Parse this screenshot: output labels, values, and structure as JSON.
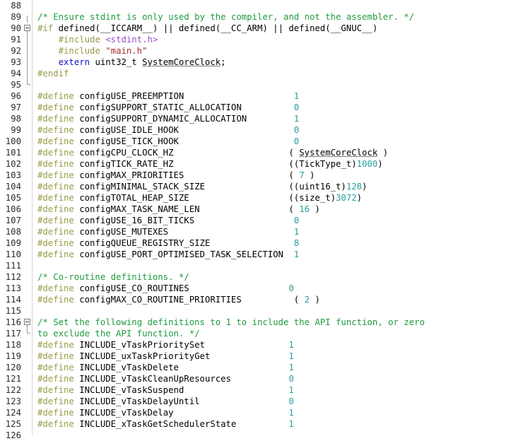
{
  "editor": {
    "name": "code-editor",
    "language": "c",
    "first_visible_line": 88,
    "last_visible_line": 126,
    "colors": {
      "background": "#ffffff",
      "gutter_text": "#2b2b2b",
      "gutter_separator": "#d4d4d4",
      "comment": "#1f9b3f",
      "preprocessor": "#9a9a4a",
      "keyword": "#1212c8",
      "number": "#2a9d9d",
      "string": "#a03030",
      "include_path": "#9b4fc8",
      "plain_text": "#000000",
      "fold_marker": "#808080"
    },
    "lines": [
      {
        "n": "88",
        "fold": "none",
        "tokens": []
      },
      {
        "n": "89",
        "fold": "region-half",
        "tokens": [
          {
            "t": "comment",
            "s": "/* Ensure stdint is only used by the compiler, and not the assembler. */"
          }
        ]
      },
      {
        "n": "90",
        "fold": "box-open",
        "tokens": [
          {
            "t": "pre",
            "s": "#if"
          },
          {
            "t": "plain",
            "s": " defined(__ICCARM__) || defined(__CC_ARM) || defined(__GNUC__)"
          }
        ]
      },
      {
        "n": "91",
        "fold": "region",
        "tokens": [
          {
            "t": "plain",
            "s": "    "
          },
          {
            "t": "pre",
            "s": "#include"
          },
          {
            "t": "plain",
            "s": " "
          },
          {
            "t": "include",
            "s": "<stdint.h>"
          }
        ]
      },
      {
        "n": "92",
        "fold": "region",
        "tokens": [
          {
            "t": "plain",
            "s": "    "
          },
          {
            "t": "pre",
            "s": "#include"
          },
          {
            "t": "plain",
            "s": " "
          },
          {
            "t": "string",
            "s": "\"main.h\""
          }
        ]
      },
      {
        "n": "93",
        "fold": "region",
        "tokens": [
          {
            "t": "plain",
            "s": "    "
          },
          {
            "t": "keyword",
            "s": "extern"
          },
          {
            "t": "plain",
            "s": " uint32_t "
          },
          {
            "t": "squiggle",
            "s": "SystemCoreClock"
          },
          {
            "t": "plain",
            "s": ";"
          }
        ]
      },
      {
        "n": "94",
        "fold": "region",
        "tokens": [
          {
            "t": "pre",
            "s": "#endif"
          }
        ]
      },
      {
        "n": "95",
        "fold": "region-end",
        "tokens": []
      },
      {
        "n": "96",
        "fold": "none",
        "tokens": [
          {
            "t": "pre",
            "s": "#define"
          },
          {
            "t": "plain",
            "s": " configUSE_PREEMPTION"
          },
          {
            "t": "pad",
            "s": "                     "
          },
          {
            "t": "number",
            "s": "1"
          }
        ]
      },
      {
        "n": "97",
        "fold": "none",
        "tokens": [
          {
            "t": "pre",
            "s": "#define"
          },
          {
            "t": "plain",
            "s": " configSUPPORT_STATIC_ALLOCATION"
          },
          {
            "t": "pad",
            "s": "          "
          },
          {
            "t": "number",
            "s": "0"
          }
        ]
      },
      {
        "n": "98",
        "fold": "none",
        "tokens": [
          {
            "t": "pre",
            "s": "#define"
          },
          {
            "t": "plain",
            "s": " configSUPPORT_DYNAMIC_ALLOCATION"
          },
          {
            "t": "pad",
            "s": "         "
          },
          {
            "t": "number",
            "s": "1"
          }
        ]
      },
      {
        "n": "99",
        "fold": "none",
        "tokens": [
          {
            "t": "pre",
            "s": "#define"
          },
          {
            "t": "plain",
            "s": " configUSE_IDLE_HOOK"
          },
          {
            "t": "pad",
            "s": "                      "
          },
          {
            "t": "number",
            "s": "0"
          }
        ]
      },
      {
        "n": "100",
        "fold": "none",
        "tokens": [
          {
            "t": "pre",
            "s": "#define"
          },
          {
            "t": "plain",
            "s": " configUSE_TICK_HOOK"
          },
          {
            "t": "pad",
            "s": "                      "
          },
          {
            "t": "number",
            "s": "0"
          }
        ]
      },
      {
        "n": "101",
        "fold": "none",
        "tokens": [
          {
            "t": "pre",
            "s": "#define"
          },
          {
            "t": "plain",
            "s": " configCPU_CLOCK_HZ"
          },
          {
            "t": "pad",
            "s": "                      "
          },
          {
            "t": "plain",
            "s": "( "
          },
          {
            "t": "squiggle",
            "s": "SystemCoreClock"
          },
          {
            "t": "plain",
            "s": " )"
          }
        ]
      },
      {
        "n": "102",
        "fold": "none",
        "tokens": [
          {
            "t": "pre",
            "s": "#define"
          },
          {
            "t": "plain",
            "s": " configTICK_RATE_HZ"
          },
          {
            "t": "pad",
            "s": "                      "
          },
          {
            "t": "plain",
            "s": "((TickType_t)"
          },
          {
            "t": "number",
            "s": "1000"
          },
          {
            "t": "plain",
            "s": ")"
          }
        ]
      },
      {
        "n": "103",
        "fold": "none",
        "tokens": [
          {
            "t": "pre",
            "s": "#define"
          },
          {
            "t": "plain",
            "s": " configMAX_PRIORITIES"
          },
          {
            "t": "pad",
            "s": "                    "
          },
          {
            "t": "plain",
            "s": "( "
          },
          {
            "t": "number",
            "s": "7"
          },
          {
            "t": "plain",
            "s": " )"
          }
        ]
      },
      {
        "n": "104",
        "fold": "none",
        "tokens": [
          {
            "t": "pre",
            "s": "#define"
          },
          {
            "t": "plain",
            "s": " configMINIMAL_STACK_SIZE"
          },
          {
            "t": "pad",
            "s": "                "
          },
          {
            "t": "plain",
            "s": "((uint16_t)"
          },
          {
            "t": "number",
            "s": "128"
          },
          {
            "t": "plain",
            "s": ")"
          }
        ]
      },
      {
        "n": "105",
        "fold": "none",
        "tokens": [
          {
            "t": "pre",
            "s": "#define"
          },
          {
            "t": "plain",
            "s": " configTOTAL_HEAP_SIZE"
          },
          {
            "t": "pad",
            "s": "                   "
          },
          {
            "t": "plain",
            "s": "((size_t)"
          },
          {
            "t": "number",
            "s": "3072"
          },
          {
            "t": "plain",
            "s": ")"
          }
        ]
      },
      {
        "n": "106",
        "fold": "none",
        "tokens": [
          {
            "t": "pre",
            "s": "#define"
          },
          {
            "t": "plain",
            "s": " configMAX_TASK_NAME_LEN"
          },
          {
            "t": "pad",
            "s": "                 "
          },
          {
            "t": "plain",
            "s": "( "
          },
          {
            "t": "number",
            "s": "16"
          },
          {
            "t": "plain",
            "s": " )"
          }
        ]
      },
      {
        "n": "107",
        "fold": "none",
        "tokens": [
          {
            "t": "pre",
            "s": "#define"
          },
          {
            "t": "plain",
            "s": " configUSE_16_BIT_TICKS"
          },
          {
            "t": "pad",
            "s": "                   "
          },
          {
            "t": "number",
            "s": "0"
          }
        ]
      },
      {
        "n": "108",
        "fold": "none",
        "tokens": [
          {
            "t": "pre",
            "s": "#define"
          },
          {
            "t": "plain",
            "s": " configUSE_MUTEXES"
          },
          {
            "t": "pad",
            "s": "                        "
          },
          {
            "t": "number",
            "s": "1"
          }
        ]
      },
      {
        "n": "109",
        "fold": "none",
        "tokens": [
          {
            "t": "pre",
            "s": "#define"
          },
          {
            "t": "plain",
            "s": " configQUEUE_REGISTRY_SIZE"
          },
          {
            "t": "pad",
            "s": "                "
          },
          {
            "t": "number",
            "s": "8"
          }
        ]
      },
      {
        "n": "110",
        "fold": "none",
        "tokens": [
          {
            "t": "pre",
            "s": "#define"
          },
          {
            "t": "plain",
            "s": " configUSE_PORT_OPTIMISED_TASK_SELECTION"
          },
          {
            "t": "pad",
            "s": "  "
          },
          {
            "t": "number",
            "s": "1"
          }
        ]
      },
      {
        "n": "111",
        "fold": "none",
        "tokens": []
      },
      {
        "n": "112",
        "fold": "none",
        "tokens": [
          {
            "t": "comment",
            "s": "/* Co-routine definitions. */"
          }
        ]
      },
      {
        "n": "113",
        "fold": "none",
        "tokens": [
          {
            "t": "pre",
            "s": "#define"
          },
          {
            "t": "plain",
            "s": " configUSE_CO_ROUTINES"
          },
          {
            "t": "pad",
            "s": "                   "
          },
          {
            "t": "number",
            "s": "0"
          }
        ]
      },
      {
        "n": "114",
        "fold": "none",
        "tokens": [
          {
            "t": "pre",
            "s": "#define"
          },
          {
            "t": "plain",
            "s": " configMAX_CO_ROUTINE_PRIORITIES"
          },
          {
            "t": "pad",
            "s": "          "
          },
          {
            "t": "plain",
            "s": "( "
          },
          {
            "t": "number",
            "s": "2"
          },
          {
            "t": "plain",
            "s": " )"
          }
        ]
      },
      {
        "n": "115",
        "fold": "none",
        "tokens": []
      },
      {
        "n": "116",
        "fold": "box-open",
        "tokens": [
          {
            "t": "comment",
            "s": "/* Set the following definitions to 1 to include the API function, or zero"
          }
        ]
      },
      {
        "n": "117",
        "fold": "region-end",
        "tokens": [
          {
            "t": "comment",
            "s": "to exclude the API function. */"
          }
        ]
      },
      {
        "n": "118",
        "fold": "none",
        "tokens": [
          {
            "t": "pre",
            "s": "#define"
          },
          {
            "t": "plain",
            "s": " INCLUDE_vTaskPrioritySet"
          },
          {
            "t": "pad",
            "s": "                "
          },
          {
            "t": "number",
            "s": "1"
          }
        ]
      },
      {
        "n": "119",
        "fold": "none",
        "tokens": [
          {
            "t": "pre",
            "s": "#define"
          },
          {
            "t": "plain",
            "s": " INCLUDE_uxTaskPriorityGet"
          },
          {
            "t": "pad",
            "s": "               "
          },
          {
            "t": "number",
            "s": "1"
          }
        ]
      },
      {
        "n": "120",
        "fold": "none",
        "tokens": [
          {
            "t": "pre",
            "s": "#define"
          },
          {
            "t": "plain",
            "s": " INCLUDE_vTaskDelete"
          },
          {
            "t": "pad",
            "s": "                     "
          },
          {
            "t": "number",
            "s": "1"
          }
        ]
      },
      {
        "n": "121",
        "fold": "none",
        "tokens": [
          {
            "t": "pre",
            "s": "#define"
          },
          {
            "t": "plain",
            "s": " INCLUDE_vTaskCleanUpResources"
          },
          {
            "t": "pad",
            "s": "           "
          },
          {
            "t": "number",
            "s": "0"
          }
        ]
      },
      {
        "n": "122",
        "fold": "none",
        "tokens": [
          {
            "t": "pre",
            "s": "#define"
          },
          {
            "t": "plain",
            "s": " INCLUDE_vTaskSuspend"
          },
          {
            "t": "pad",
            "s": "                    "
          },
          {
            "t": "number",
            "s": "1"
          }
        ]
      },
      {
        "n": "123",
        "fold": "none",
        "tokens": [
          {
            "t": "pre",
            "s": "#define"
          },
          {
            "t": "plain",
            "s": " INCLUDE_vTaskDelayUntil"
          },
          {
            "t": "pad",
            "s": "                 "
          },
          {
            "t": "number",
            "s": "0"
          }
        ]
      },
      {
        "n": "124",
        "fold": "none",
        "tokens": [
          {
            "t": "pre",
            "s": "#define"
          },
          {
            "t": "plain",
            "s": " INCLUDE_vTaskDelay"
          },
          {
            "t": "pad",
            "s": "                      "
          },
          {
            "t": "number",
            "s": "1"
          }
        ]
      },
      {
        "n": "125",
        "fold": "none",
        "tokens": [
          {
            "t": "pre",
            "s": "#define"
          },
          {
            "t": "plain",
            "s": " INCLUDE_xTaskGetSchedulerState"
          },
          {
            "t": "pad",
            "s": "          "
          },
          {
            "t": "number",
            "s": "1"
          }
        ]
      },
      {
        "n": "126",
        "fold": "none",
        "tokens": []
      }
    ]
  }
}
